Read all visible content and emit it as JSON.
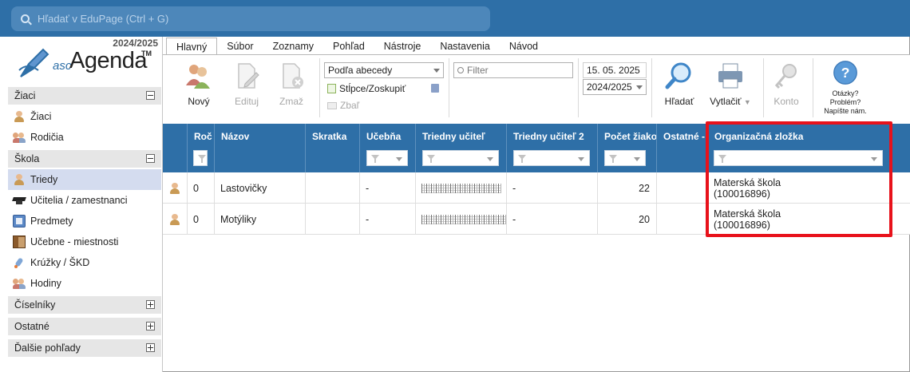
{
  "search": {
    "placeholder": "Hľadať v EduPage (Ctrl + G)"
  },
  "sidebar": {
    "year": "2024/2025",
    "logo": {
      "asc": "asc",
      "name": "Agenda",
      "tm": "TM"
    },
    "groups": [
      {
        "label": "Žiaci",
        "expanded": true,
        "items": [
          {
            "label": "Žiaci",
            "icon": "student-icon"
          },
          {
            "label": "Rodičia",
            "icon": "parents-icon"
          }
        ]
      },
      {
        "label": "Škola",
        "expanded": true,
        "items": [
          {
            "label": "Triedy",
            "icon": "class-icon",
            "active": true
          },
          {
            "label": "Učitelia / zamestnanci",
            "icon": "graduation-cap-icon"
          },
          {
            "label": "Predmety",
            "icon": "book-icon"
          },
          {
            "label": "Učebne - miestnosti",
            "icon": "door-icon"
          },
          {
            "label": "Krúžky / ŠKD",
            "icon": "rocket-icon"
          },
          {
            "label": "Hodiny",
            "icon": "group-icon"
          }
        ]
      },
      {
        "label": "Číselníky",
        "expanded": false
      },
      {
        "label": "Ostatné",
        "expanded": false
      },
      {
        "label": "Ďalšie pohľady",
        "expanded": false
      }
    ]
  },
  "tabs": [
    "Hlavný",
    "Súbor",
    "Zoznamy",
    "Pohľad",
    "Nástroje",
    "Nastavenia",
    "Návod"
  ],
  "ribbon": {
    "new": "Nový",
    "edit": "Edituj",
    "delete": "Zmaž",
    "sort": "Podľa abecedy",
    "columns": "Stĺpce/Zoskupiť",
    "collapse": "Zbaľ",
    "filter_placeholder": "Filter",
    "date": "15. 05. 2025",
    "school_year": "2024/2025",
    "find": "Hľadať",
    "print": "Vytlačiť",
    "account": "Konto",
    "help_line1": "Otázky?",
    "help_line2": "Problém?",
    "help_line3": "Napíšte nám."
  },
  "table": {
    "columns": [
      "Roč",
      "Názov",
      "Skratka",
      "Učebňa",
      "Triedny učiteľ",
      "Triedny učiteľ 2",
      "Počet žiakov",
      "Ostatné -",
      "Organizačná zložka"
    ],
    "rows": [
      {
        "year": "0",
        "name": "Lastovičky",
        "abbr": "",
        "room": "-",
        "teacher2": "-",
        "count": "22",
        "other": "",
        "org_line1": "Materská škola",
        "org_line2": "(100016896)"
      },
      {
        "year": "0",
        "name": "Motýliky",
        "abbr": "",
        "room": "-",
        "teacher2": "-",
        "count": "20",
        "other": "",
        "org_line1": "Materská škola",
        "org_line2": "(100016896)"
      }
    ]
  },
  "colors": {
    "header": "#2e6fa7",
    "highlight": "#e8121b",
    "active_item": "#d4dcef"
  }
}
